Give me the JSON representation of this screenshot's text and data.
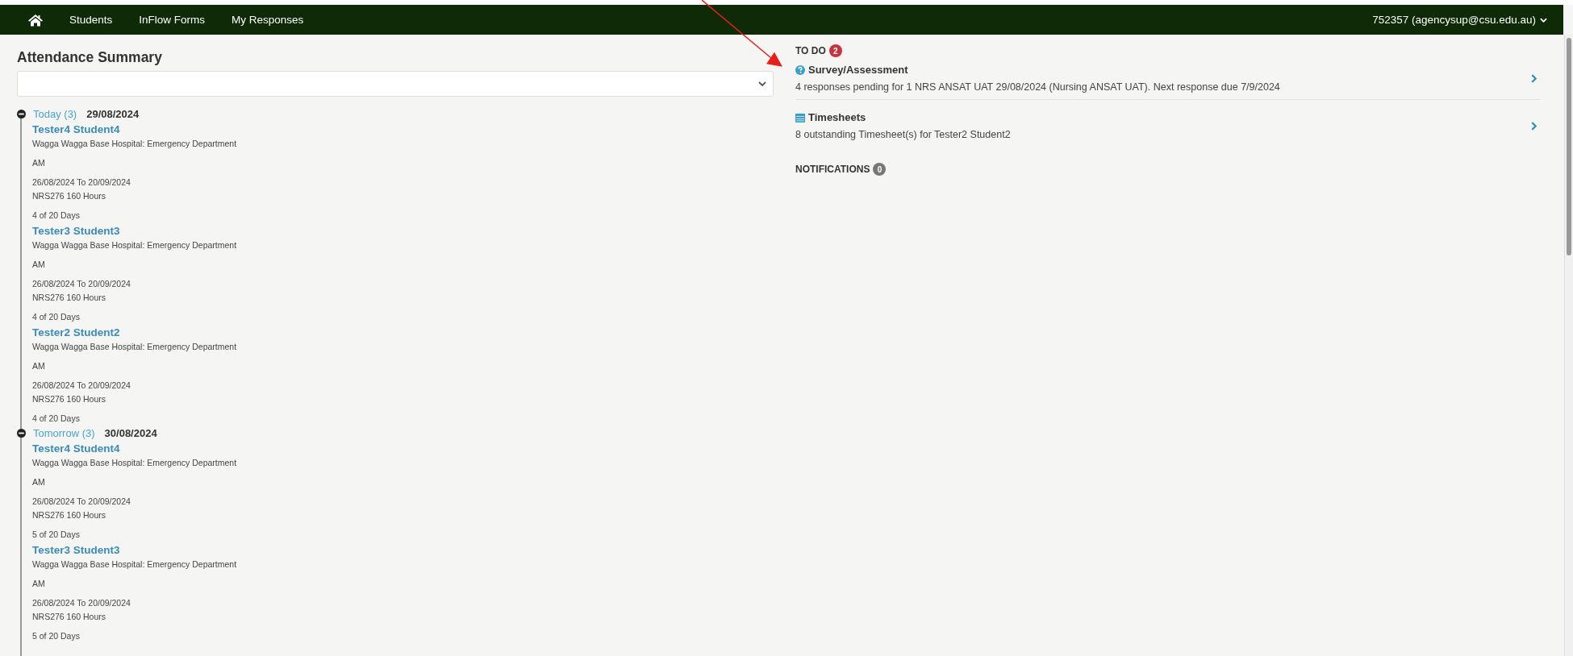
{
  "nav": {
    "items": [
      {
        "label": "Students"
      },
      {
        "label": "InFlow Forms"
      },
      {
        "label": "My Responses"
      }
    ],
    "user": "752357 (agencysup@csu.edu.au)"
  },
  "attendance": {
    "title": "Attendance Summary",
    "groups": [
      {
        "label": "Today (3)",
        "date": "29/08/2024",
        "expanded": true,
        "students": [
          {
            "name": "Tester4 Student4",
            "location": "Wagga Wagga Base Hospital: Emergency Department",
            "session": "AM",
            "dates": "26/08/2024 To 20/09/2024",
            "unit": "NRS276 160 Hours",
            "progress": "4 of 20 Days"
          },
          {
            "name": "Tester3 Student3",
            "location": "Wagga Wagga Base Hospital: Emergency Department",
            "session": "AM",
            "dates": "26/08/2024 To 20/09/2024",
            "unit": "NRS276 160 Hours",
            "progress": "4 of 20 Days"
          },
          {
            "name": "Tester2 Student2",
            "location": "Wagga Wagga Base Hospital: Emergency Department",
            "session": "AM",
            "dates": "26/08/2024 To 20/09/2024",
            "unit": "NRS276 160 Hours",
            "progress": "4 of 20 Days"
          }
        ]
      },
      {
        "label": "Tomorrow (3)",
        "date": "30/08/2024",
        "expanded": true,
        "students": [
          {
            "name": "Tester4 Student4",
            "location": "Wagga Wagga Base Hospital: Emergency Department",
            "session": "AM",
            "dates": "26/08/2024 To 20/09/2024",
            "unit": "NRS276 160 Hours",
            "progress": "5 of 20 Days"
          },
          {
            "name": "Tester3 Student3",
            "location": "Wagga Wagga Base Hospital: Emergency Department",
            "session": "AM",
            "dates": "26/08/2024 To 20/09/2024",
            "unit": "NRS276 160 Hours",
            "progress": "5 of 20 Days"
          }
        ]
      }
    ]
  },
  "todo": {
    "title": "TO DO",
    "count": "2",
    "items": [
      {
        "kind": "survey",
        "title": "Survey/Assessment",
        "text": "4 responses pending for 1 NRS ANSAT UAT 29/08/2024 (Nursing ANSAT UAT). Next response due 7/9/2024"
      },
      {
        "kind": "timesheet",
        "title": "Timesheets",
        "text": "8 outstanding Timesheet(s) for Tester2 Student2"
      }
    ]
  },
  "notifications": {
    "title": "NOTIFICATIONS",
    "count": "0"
  }
}
